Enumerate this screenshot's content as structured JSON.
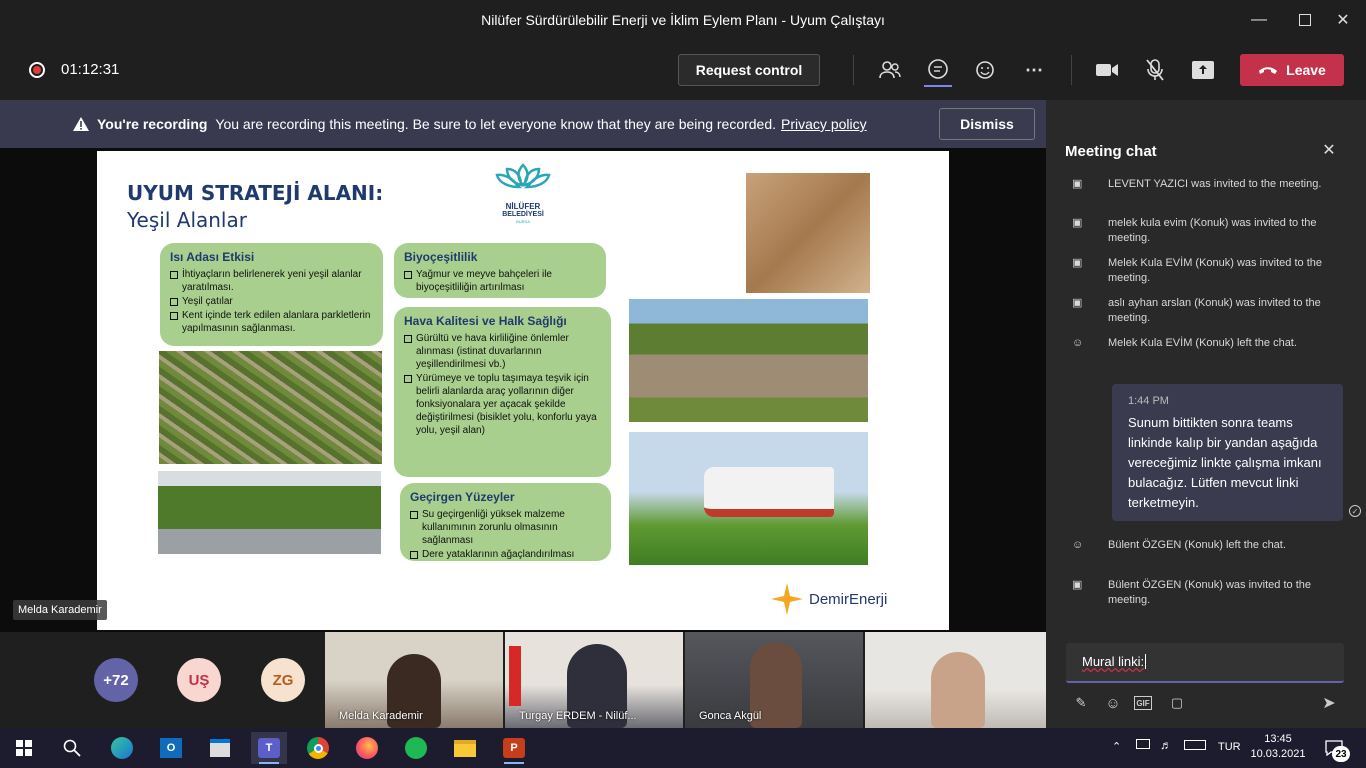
{
  "window": {
    "title": "Nilüfer Sürdürülebilir Enerji ve İklim Eylem Planı - Uyum Çalıştayı"
  },
  "controls": {
    "timer": "01:12:31",
    "request_control": "Request control",
    "leave": "Leave"
  },
  "banner": {
    "label": "You're recording",
    "message": "You are recording this meeting. Be sure to let everyone know that they are being recorded.",
    "privacy_link": "Privacy policy",
    "dismiss": "Dismiss"
  },
  "presenter_name": "Melda Karademir",
  "slide": {
    "title_line1": "UYUM STRATEJİ ALANI:",
    "title_line2": "Yeşil Alanlar",
    "logo_name": "NİLÜFER",
    "logo_sub": "BELEDİYESİ",
    "logo_city": "BURSA",
    "brand": "DemirEnerji",
    "boxes": [
      {
        "title": "Isı Adası Etkisi",
        "items": [
          "İhtiyaçların belirlenerek yeni yeşil alanlar yaratılması.",
          "Yeşil çatılar",
          "Kent içinde terk edilen alanlara parkletlerin yapılmasının sağlanması."
        ]
      },
      {
        "title": "Biyoçeşitlilik",
        "items": [
          "Yağmur ve meyve bahçeleri ile biyoçeşitliliğin artırılması"
        ]
      },
      {
        "title": "Hava Kalitesi ve Halk Sağlığı",
        "items": [
          "Gürültü ve hava kirliliğine önlemler alınması (istinat duvarlarının yeşillendirilmesi vb.)",
          "Yürümeye ve toplu taşımaya teşvik için belirli alanlarda araç yollarının diğer fonksiyonalara yer açacak şekilde değiştirilmesi (bisiklet yolu, konforlu yaya yolu, yeşil alan)"
        ]
      },
      {
        "title": "Geçirgen Yüzeyler",
        "items": [
          "Su geçirgenliği yüksek malzeme kullanımının zorunlu olmasının sağlanması",
          "Dere yataklarının ağaçlandırılması"
        ]
      }
    ]
  },
  "participants": {
    "overflow": "+72",
    "avatars": [
      {
        "initials": "UŞ",
        "color": "#f8d7d0",
        "text_color": "#c4314b"
      },
      {
        "initials": "ZG",
        "color": "#f6e2cf",
        "text_color": "#b55d1d"
      }
    ],
    "tiles": [
      "Melda Karademir",
      "Turgay ERDEM - Nilüf...",
      "Gonca Akgül",
      ""
    ]
  },
  "chat": {
    "title": "Meeting chat",
    "events": [
      "LEVENT YAZICI was invited to the meeting.",
      "melek kula evim (Konuk) was invited to the meeting.",
      "Melek Kula EVİM (Konuk) was invited to the meeting.",
      "aslı ayhan arslan (Konuk) was invited to the meeting.",
      "Melek Kula EVİM (Konuk) left the chat."
    ],
    "message": {
      "time": "1:44 PM",
      "text": "Sunum bittikten sonra teams linkinde kalıp bir yandan aşağıda vereceğimiz linkte çalışma imkanı bulacağız. Lütfen mevcut linki terketmeyin."
    },
    "events_after": [
      "Bülent ÖZGEN (Konuk) left the chat.",
      "Bülent ÖZGEN (Konuk) was invited to the meeting."
    ],
    "compose_value": "Mural linki:"
  },
  "taskbar": {
    "language": "TUR",
    "time": "13:45",
    "date": "10.03.2021",
    "notifications": "23"
  }
}
